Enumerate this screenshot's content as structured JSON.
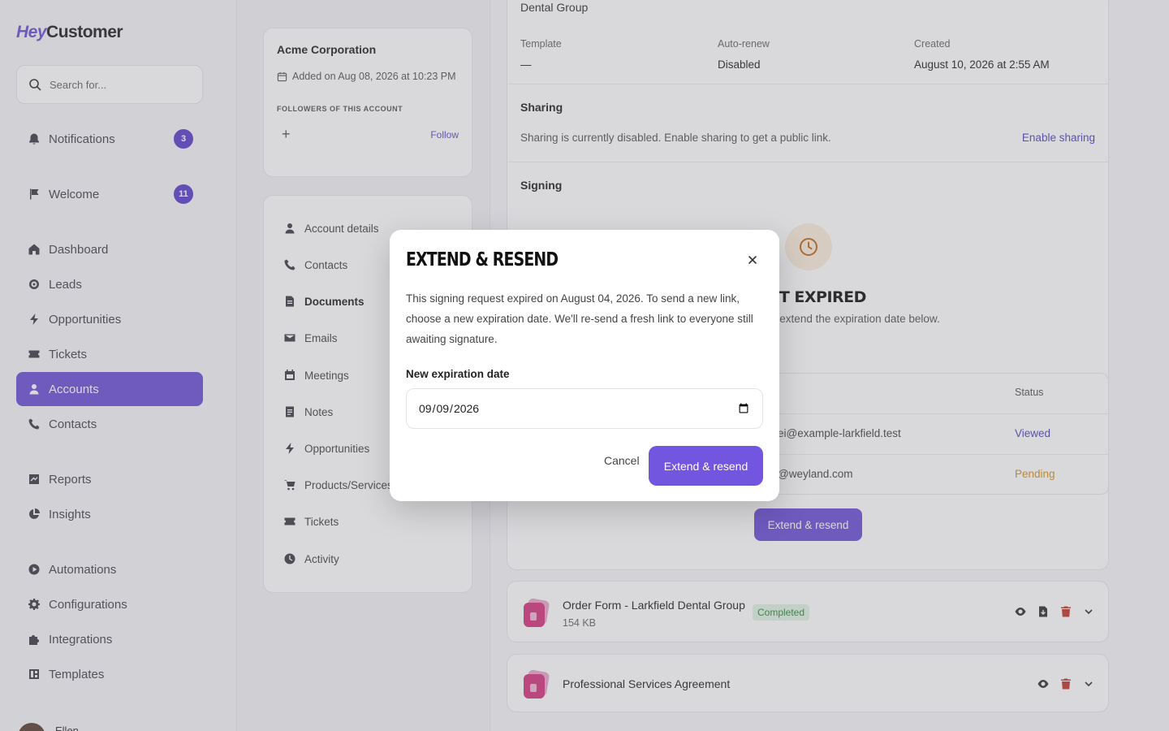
{
  "colors": {
    "accent": "#6d4fd6",
    "badge": "#5a3fc8",
    "link": "#4e44c4",
    "success": "#2f8a3b",
    "warning": "#d9920f",
    "danger": "#c0392b"
  },
  "logo": {
    "hey": "Hey",
    "customer": "Customer"
  },
  "search": {
    "placeholder": "Search for..."
  },
  "sidebar": {
    "items": [
      {
        "label": "Notifications",
        "icon": "bell-icon",
        "badge": "3"
      },
      {
        "label": "Welcome",
        "icon": "flag-icon",
        "badge": "11"
      },
      {
        "label": "Dashboard",
        "icon": "home-icon"
      },
      {
        "label": "Leads",
        "icon": "target-icon"
      },
      {
        "label": "Opportunities",
        "icon": "bolt-icon"
      },
      {
        "label": "Tickets",
        "icon": "ticket-icon"
      },
      {
        "label": "Accounts",
        "icon": "user-icon",
        "active": true
      },
      {
        "label": "Contacts",
        "icon": "phone-icon"
      },
      {
        "label": "Reports",
        "icon": "chart-icon"
      },
      {
        "label": "Insights",
        "icon": "pie-icon"
      },
      {
        "label": "Automations",
        "icon": "play-icon"
      },
      {
        "label": "Configurations",
        "icon": "gear-icon"
      },
      {
        "label": "Integrations",
        "icon": "puzzle-icon"
      },
      {
        "label": "Templates",
        "icon": "template-icon"
      }
    ],
    "user": {
      "name": "Ellen"
    }
  },
  "account": {
    "name": "Acme Corporation",
    "added": "Added on Aug 08, 2026 at 10:23 PM",
    "followers_label": "FOLLOWERS OF THIS ACCOUNT",
    "plus": "+",
    "follow": "Follow"
  },
  "subnav": {
    "items": [
      {
        "label": "Account details",
        "icon": "user-icon"
      },
      {
        "label": "Contacts",
        "icon": "phone-icon"
      },
      {
        "label": "Documents",
        "icon": "document-icon",
        "active": true
      },
      {
        "label": "Emails",
        "icon": "mail-icon"
      },
      {
        "label": "Meetings",
        "icon": "calendar-icon"
      },
      {
        "label": "Notes",
        "icon": "note-icon"
      },
      {
        "label": "Opportunities",
        "icon": "bolt-icon"
      },
      {
        "label": "Products/Services",
        "icon": "cart-icon"
      },
      {
        "label": "Tickets",
        "icon": "ticket-icon"
      },
      {
        "label": "Activity",
        "icon": "clock-icon"
      }
    ]
  },
  "document": {
    "title": "Dental Group",
    "meta": [
      {
        "label": "Template",
        "value": "—"
      },
      {
        "label": "Auto-renew",
        "value": "Disabled"
      },
      {
        "label": "Created",
        "value": "August 10, 2026 at 2:55 AM"
      }
    ],
    "sharing": {
      "title": "Sharing",
      "text": "Sharing is currently disabled. Enable sharing to get a public link.",
      "link": "Enable sharing"
    },
    "signing": {
      "title": "Signing",
      "expired_title": "REQUEST EXPIRED",
      "expired_sub": "ew signing link, extend the expiration date below.",
      "table": {
        "email_header": "l",
        "status_header": "Status",
        "rows": [
          {
            "email": "ei@example-larkfield.test",
            "status": "Viewed"
          },
          {
            "email": "@weyland.com",
            "status": "Pending"
          }
        ]
      },
      "extend_button": "Extend & resend"
    }
  },
  "files": [
    {
      "name": "Order Form - Larkfield Dental Group",
      "status": "Completed",
      "size": "154 KB"
    },
    {
      "name": "Professional Services Agreement"
    }
  ],
  "modal": {
    "title": "EXTEND & RESEND",
    "description": "This signing request expired on August 04, 2026. To send a new link, choose a new expiration date. We'll re-send a fresh link to everyone still awaiting signature.",
    "field_label": "New expiration date",
    "date_value": "2026-09-09",
    "cancel": "Cancel",
    "confirm": "Extend & resend"
  }
}
